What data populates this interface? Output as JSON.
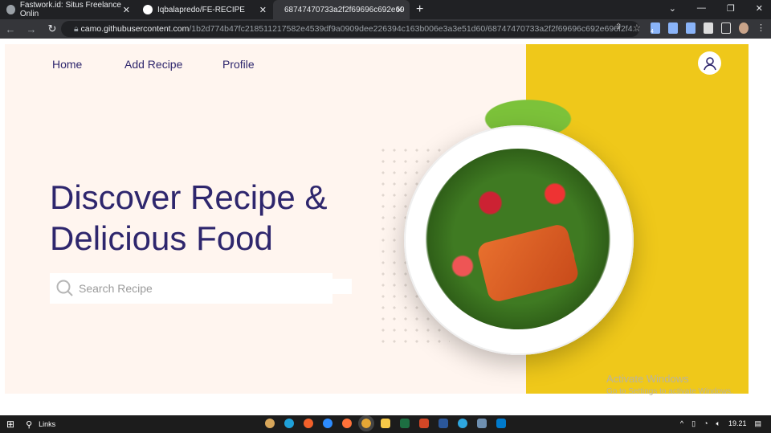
{
  "browser": {
    "tabs": [
      {
        "label": "Fastwork.id: Situs Freelance Onlin"
      },
      {
        "label": "Iqbalapredo/FE-RECIPE"
      },
      {
        "label": "68747470733a2f2f69696c692e69",
        "active": true
      }
    ],
    "url_host": "camo.githubusercontent.com",
    "url_path": "/1b2d774b47fc218511217582e4539df9a0909dee226394c163b006e3a3e51d60/68747470733a2f2f69696c692e696f2f4...",
    "ext_badge": "4"
  },
  "nav": {
    "items": [
      {
        "label": "Home"
      },
      {
        "label": "Add Recipe"
      },
      {
        "label": "Profile"
      }
    ]
  },
  "hero": {
    "line1": "Discover Recipe &",
    "line2": "Delicious Food"
  },
  "search": {
    "placeholder": "Search Recipe",
    "value": ""
  },
  "colors": {
    "primary": "#2e266d",
    "accent": "#efc81a",
    "background": "#fff5ef"
  },
  "watermark": {
    "title": "Activate Windows",
    "subtitle": "Go to Settings to activate Windows."
  },
  "taskbar": {
    "search_label": "Links",
    "time": "19.21"
  }
}
